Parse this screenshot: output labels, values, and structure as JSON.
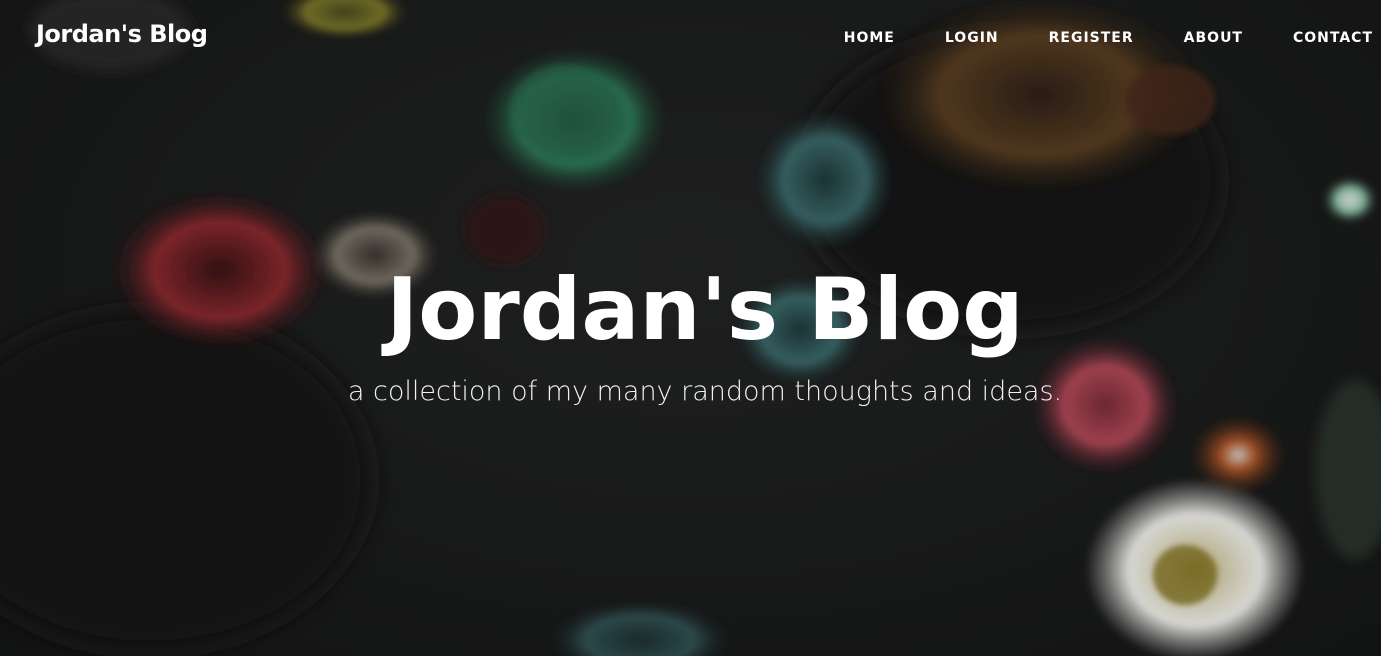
{
  "navbar": {
    "brand": "Jordan's Blog",
    "links": [
      {
        "label": "HOME"
      },
      {
        "label": "LOGIN"
      },
      {
        "label": "REGISTER"
      },
      {
        "label": "ABOUT"
      },
      {
        "label": "CONTACT"
      }
    ]
  },
  "header": {
    "title": "Jordan's Blog",
    "subtitle": "a collection of my many random thoughts and ideas."
  },
  "background": {
    "image": "dark photo of colorful sea anemones",
    "overlay_color": "#1b1b1b"
  }
}
